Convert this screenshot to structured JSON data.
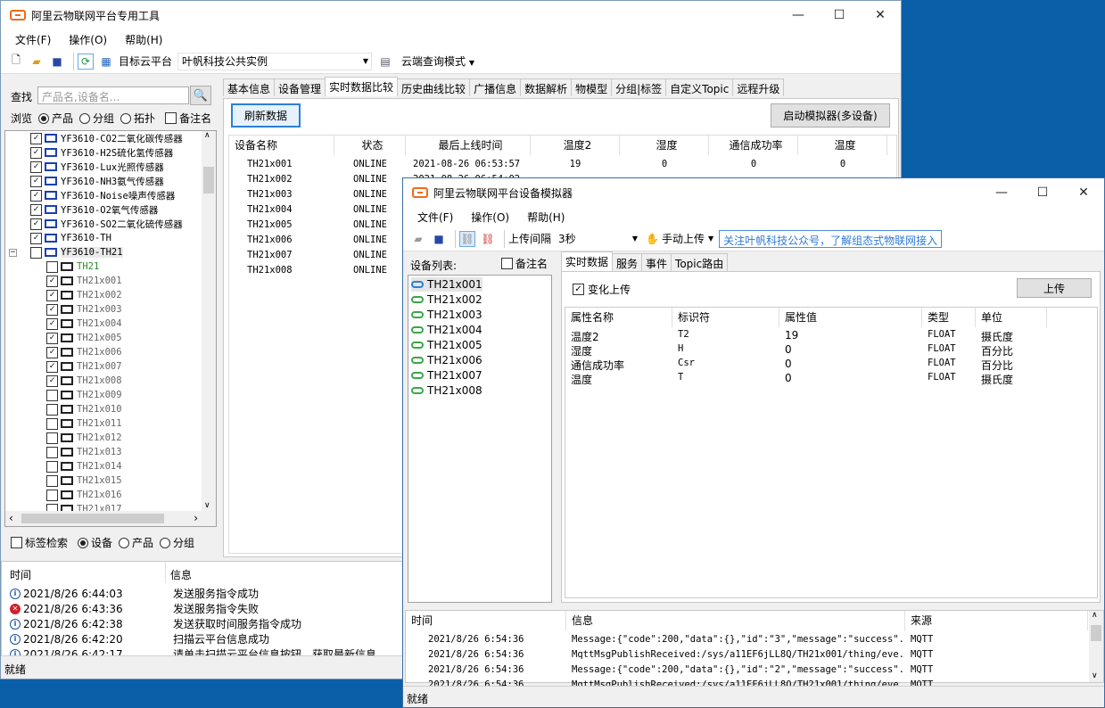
{
  "main": {
    "title": "阿里云物联网平台专用工具",
    "menu": [
      "文件(F)",
      "操作(O)",
      "帮助(H)"
    ],
    "toolbar": {
      "target_label": "目标云平台",
      "target_value": "叶帆科技公共实例",
      "mode_label": "云端查询模式"
    },
    "search": {
      "label": "查找",
      "placeholder": "产品名,设备名..."
    },
    "browse": {
      "label": "浏览",
      "opt_product": "产品",
      "opt_group": "分组",
      "opt_topology": "拓扑",
      "opt_note": "备注名"
    },
    "tree": [
      {
        "label": "YF3610-CO2二氧化碳传感器",
        "checked": true,
        "level": 1
      },
      {
        "label": "YF3610-H2S硫化氢传感器",
        "checked": true,
        "level": 1
      },
      {
        "label": "YF3610-Lux光照传感器",
        "checked": true,
        "level": 1
      },
      {
        "label": "YF3610-NH3氨气传感器",
        "checked": true,
        "level": 1
      },
      {
        "label": "YF3610-Noise噪声传感器",
        "checked": true,
        "level": 1
      },
      {
        "label": "YF3610-O2氧气传感器",
        "checked": true,
        "level": 1
      },
      {
        "label": "YF3610-SO2二氧化硫传感器",
        "checked": true,
        "level": 1
      },
      {
        "label": "YF3610-TH",
        "checked": true,
        "level": 1
      },
      {
        "label": "YF3610-TH21",
        "checked": false,
        "level": 1,
        "expanded": true
      },
      {
        "label": "TH21",
        "checked": false,
        "level": 2,
        "green": true
      },
      {
        "label": "TH21x001",
        "checked": true,
        "level": 2
      },
      {
        "label": "TH21x002",
        "checked": true,
        "level": 2
      },
      {
        "label": "TH21x003",
        "checked": true,
        "level": 2
      },
      {
        "label": "TH21x004",
        "checked": true,
        "level": 2
      },
      {
        "label": "TH21x005",
        "checked": true,
        "level": 2
      },
      {
        "label": "TH21x006",
        "checked": true,
        "level": 2
      },
      {
        "label": "TH21x007",
        "checked": true,
        "level": 2
      },
      {
        "label": "TH21x008",
        "checked": true,
        "level": 2
      },
      {
        "label": "TH21x009",
        "checked": false,
        "level": 2
      },
      {
        "label": "TH21x010",
        "checked": false,
        "level": 2
      },
      {
        "label": "TH21x011",
        "checked": false,
        "level": 2
      },
      {
        "label": "TH21x012",
        "checked": false,
        "level": 2
      },
      {
        "label": "TH21x013",
        "checked": false,
        "level": 2
      },
      {
        "label": "TH21x014",
        "checked": false,
        "level": 2
      },
      {
        "label": "TH21x015",
        "checked": false,
        "level": 2
      },
      {
        "label": "TH21x016",
        "checked": false,
        "level": 2
      },
      {
        "label": "TH21x017",
        "checked": false,
        "level": 2
      }
    ],
    "filter": {
      "tag_search": "标签检索",
      "opt_device": "设备",
      "opt_product": "产品",
      "opt_group": "分组"
    },
    "tabs": [
      "基本信息",
      "设备管理",
      "实时数据比较",
      "历史曲线比较",
      "广播信息",
      "数据解析",
      "物模型",
      "分组|标签",
      "自定义Topic",
      "远程升级"
    ],
    "active_tab": 2,
    "refresh_button": "刷新数据",
    "simulator_button": "启动模拟器(多设备)",
    "grid_headers": [
      "设备名称",
      "状态",
      "最后上线时间",
      "温度2",
      "湿度",
      "通信成功率",
      "温度"
    ],
    "grid_rows": [
      [
        "TH21x001",
        "ONLINE",
        "2021-08-26 06:53:57",
        "19",
        "0",
        "0",
        "0"
      ],
      [
        "TH21x002",
        "ONLINE",
        "2021-08-26 06:54:02",
        "",
        "",
        "",
        ""
      ],
      [
        "TH21x003",
        "ONLINE",
        "",
        "",
        "",
        "",
        ""
      ],
      [
        "TH21x004",
        "ONLINE",
        "",
        "",
        "",
        "",
        ""
      ],
      [
        "TH21x005",
        "ONLINE",
        "",
        "",
        "",
        "",
        ""
      ],
      [
        "TH21x006",
        "ONLINE",
        "",
        "",
        "",
        "",
        ""
      ],
      [
        "TH21x007",
        "ONLINE",
        "",
        "",
        "",
        "",
        ""
      ],
      [
        "TH21x008",
        "ONLINE",
        "",
        "",
        "",
        "",
        ""
      ]
    ],
    "log_headers": [
      "时间",
      "信息"
    ],
    "log_rows": [
      {
        "icon": "info",
        "time": "2021/8/26 6:44:03",
        "msg": "发送服务指令成功"
      },
      {
        "icon": "error",
        "time": "2021/8/26 6:43:36",
        "msg": "发送服务指令失败"
      },
      {
        "icon": "info",
        "time": "2021/8/26 6:42:38",
        "msg": "发送获取时间服务指令成功"
      },
      {
        "icon": "info",
        "time": "2021/8/26 6:42:20",
        "msg": "扫描云平台信息成功"
      },
      {
        "icon": "info",
        "time": "2021/8/26 6:42:17",
        "msg": "请单击扫描云平台信息按钮，获取最新信息"
      }
    ],
    "status": "就绪"
  },
  "sim": {
    "title": "阿里云物联网平台设备模拟器",
    "menu": [
      "文件(F)",
      "操作(O)",
      "帮助(H)"
    ],
    "toolbar": {
      "interval_label": "上传间隔",
      "interval_value": "3秒",
      "manual_label": "手动上传",
      "notice": "关注叶帆科技公众号，了解组态式物联网接入"
    },
    "device_list_label": "设备列表:",
    "note_label": "备注名",
    "devices": [
      "TH21x001",
      "TH21x002",
      "TH21x003",
      "TH21x004",
      "TH21x005",
      "TH21x006",
      "TH21x007",
      "TH21x008"
    ],
    "tabs": [
      "实时数据",
      "服务",
      "事件",
      "Topic路由"
    ],
    "change_upload": "变化上传",
    "upload_button": "上传",
    "prop_headers": [
      "属性名称",
      "标识符",
      "属性值",
      "类型",
      "单位"
    ],
    "props": [
      [
        "温度2",
        "T2",
        "19",
        "FLOAT",
        "摄氏度"
      ],
      [
        "湿度",
        "H",
        "0",
        "FLOAT",
        "百分比"
      ],
      [
        "通信成功率",
        "Csr",
        "0",
        "FLOAT",
        "百分比"
      ],
      [
        "温度",
        "T",
        "0",
        "FLOAT",
        "摄氏度"
      ]
    ],
    "log_headers": [
      "时间",
      "信息",
      "来源"
    ],
    "log_rows": [
      [
        "2021/8/26 6:54:36",
        "Message:{\"code\":200,\"data\":{},\"id\":\"3\",\"message\":\"success\"...",
        "MQTT"
      ],
      [
        "2021/8/26 6:54:36",
        "MqttMsgPublishReceived:/sys/a11EF6jLL8Q/TH21x001/thing/eve...",
        "MQTT"
      ],
      [
        "2021/8/26 6:54:36",
        "Message:{\"code\":200,\"data\":{},\"id\":\"2\",\"message\":\"success\"...",
        "MQTT"
      ],
      [
        "2021/8/26 6:54:36",
        "MqttMsgPublishReceived:/sys/a11EF6jLL8Q/TH21x001/thing/eve...",
        "MQTT"
      ]
    ],
    "status": "就绪"
  },
  "icons": {
    "minimize": "minimize-icon",
    "maximize": "maximize-icon",
    "close": "close-icon"
  },
  "colors": {
    "desktop": "#0b5ea8",
    "logo": "#f06a1b",
    "device_icon": "#1a3fb0",
    "link_icon": "#3aa64a",
    "error": "#d0202a"
  }
}
